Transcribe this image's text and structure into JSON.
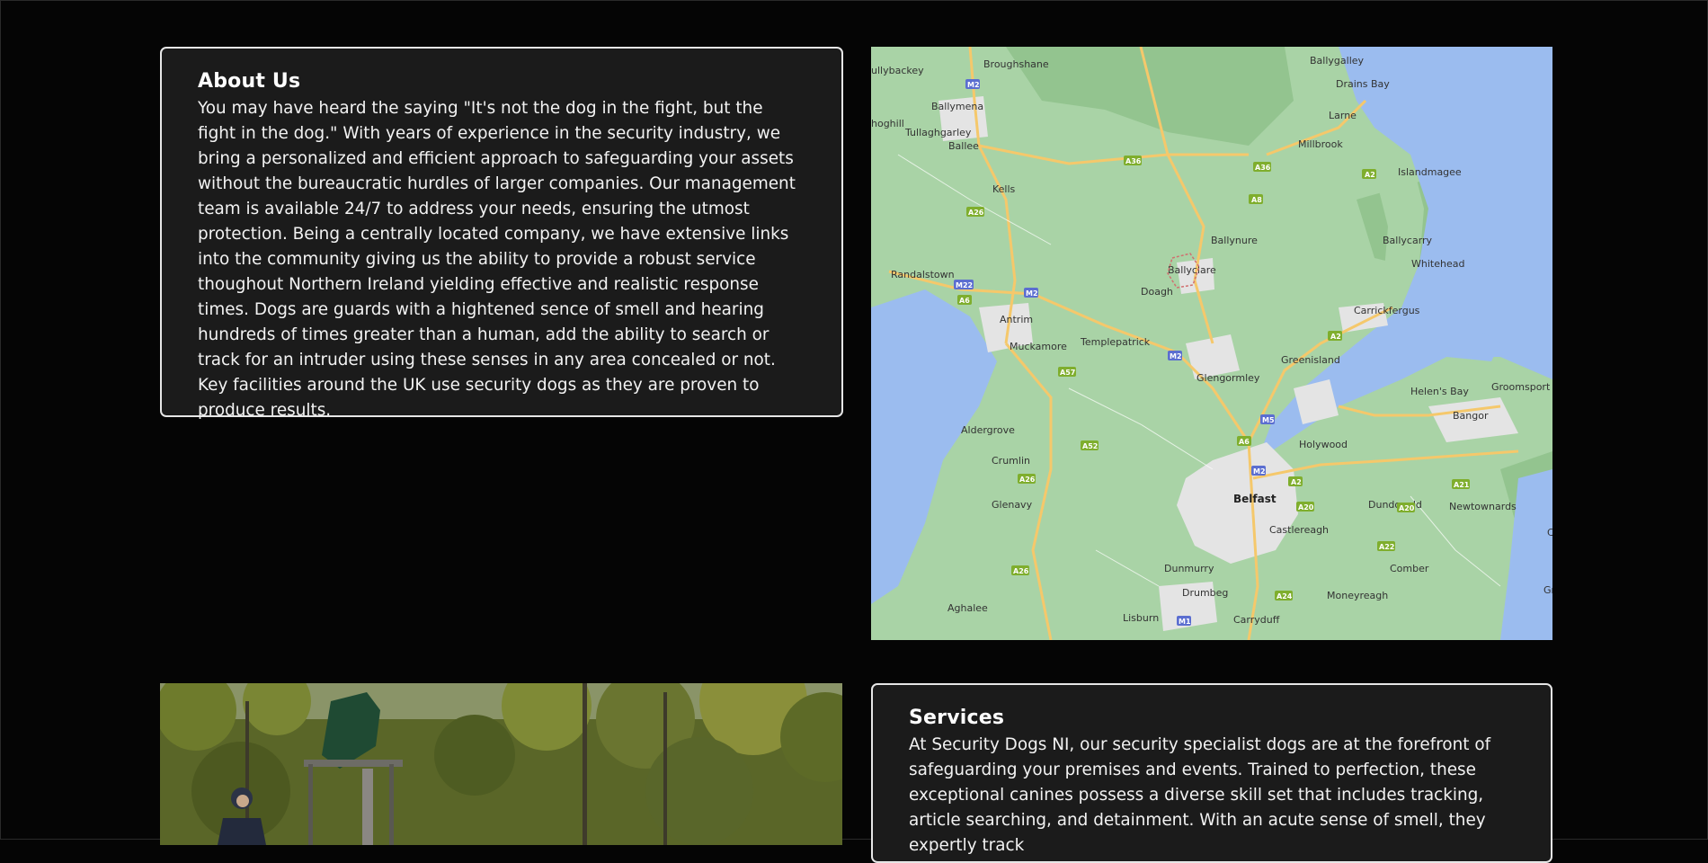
{
  "about": {
    "title": "About Us",
    "body": "You may have heard the saying \"It's not the dog in the fight, but the fight in the dog.\" With years of experience in the security industry, we bring a personalized and efficient approach to safeguarding your assets without the bureaucratic hurdles of larger companies. Our management team is available 24/7 to address your needs, ensuring the utmost protection. Being a centrally located company, we have extensive links into the community giving us the ability to provide a robust service thoughout Northern Ireland yielding effective and realistic response times. Dogs are guards with a hightened sence of smell and hearing hundreds of times greater than a human, add the ability to search or track for an intruder using these senses in any area concealed or not. Key facilities around the UK use security dogs as they are proven to produce results."
  },
  "services": {
    "title": "Services",
    "body": "At Security Dogs NI, our security specialist dogs are at the forefront of safeguarding your premises and events. Trained to perfection, these exceptional canines possess a diverse skill set that includes tracking, article searching, and detainment. With an acute sense of smell, they expertly track"
  },
  "map": {
    "places": {
      "ballygalley": "Ballygalley",
      "broughshane": "Broughshane",
      "ballybackey": "ullybackey",
      "drains_bay": "Drains Bay",
      "ballymena": "Ballymena",
      "larne": "Larne",
      "ahoghill": "hoghill",
      "tullaghgarley": "Tullaghgarley",
      "ballee": "Ballee",
      "millbrook": "Millbrook",
      "islandmagee": "Islandmagee",
      "kells": "Kells",
      "ballynure": "Ballynure",
      "ballycarry": "Ballycarry",
      "whitehead": "Whitehead",
      "ballyclare": "Ballyclare",
      "randalstown": "Randalstown",
      "doagh": "Doagh",
      "antrim": "Antrim",
      "carrickfergus": "Carrickfergus",
      "templepatrick": "Templepatrick",
      "muckamore": "Muckamore",
      "greenisland": "Greenisland",
      "glengormley": "Glengormley",
      "helens_bay": "Helen's Bay",
      "groomsport": "Groomsport",
      "bangor": "Bangor",
      "aldergrove": "Aldergrove",
      "holywood": "Holywood",
      "crumlin": "Crumlin",
      "belfast": "Belfast",
      "dundonald": "Dundonald",
      "newtownards": "Newtownards",
      "glenavy": "Glenavy",
      "castlereagh": "Castlereagh",
      "dunmurry": "Dunmurry",
      "comber": "Comber",
      "drumbeg": "Drumbeg",
      "moneyreagh": "Moneyreagh",
      "aghalee": "Aghalee",
      "lisburn": "Lisburn",
      "carryduff": "Carryduff",
      "ca_edge": "Ca",
      "gr_edge": "Gr"
    },
    "roads": {
      "m2_north": "M2",
      "a36_west": "A36",
      "a36_east": "A36",
      "a2_larne": "A2",
      "a8": "A8",
      "a26_kells": "A26",
      "m22": "M22",
      "a6": "A6",
      "m2_antrim": "M2",
      "m2_templepatrick": "M2",
      "a2_carrick": "A2",
      "a57": "A57",
      "m5": "M5",
      "a6_belfast": "A6",
      "a52": "A52",
      "m2_belfast": "M2",
      "a2_holywood": "A2",
      "a26_crumlin": "A26",
      "a20": "A20",
      "a20_east": "A20",
      "a21": "A21",
      "a22": "A22",
      "a26_south": "A26",
      "a24": "A24",
      "m1": "M1"
    },
    "colors": {
      "land": "#a9d3a6",
      "water": "#9bbcef",
      "urban": "#e4e4e4",
      "road_major": "#f5c86b",
      "motorway_shield": "#5b6ed0",
      "a_road_shield": "#7fae2d"
    }
  },
  "photo": {
    "colors": {
      "foliage": "#6b7a2f",
      "tarp": "#1f4a33",
      "sky": "#c9d4c1"
    }
  }
}
